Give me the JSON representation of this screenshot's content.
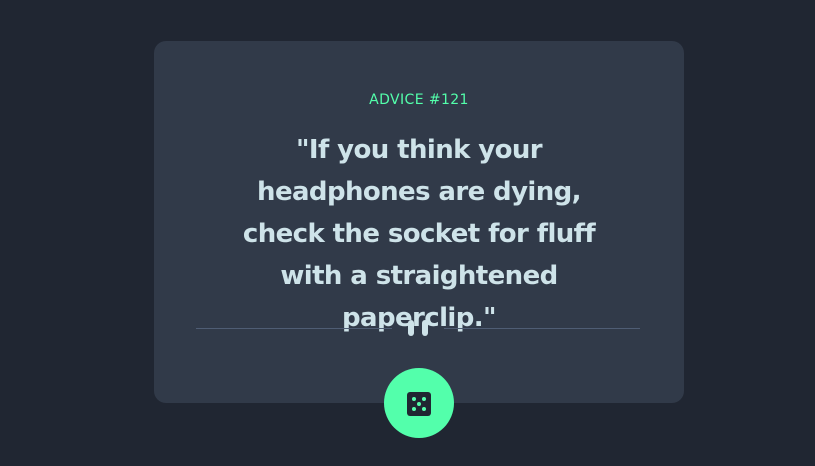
{
  "advice": {
    "id_label": "ADVICE #121",
    "quote": "\"If you think your headphones are dying, check the socket for fluff with a straightened paperclip.\""
  },
  "icons": {
    "divider": "pause-icon",
    "button": "dice-icon"
  },
  "colors": {
    "background": "#202632",
    "card": "#313a49",
    "accent": "#53ffab",
    "text": "#cee3e9",
    "divider": "#4f5d74"
  }
}
